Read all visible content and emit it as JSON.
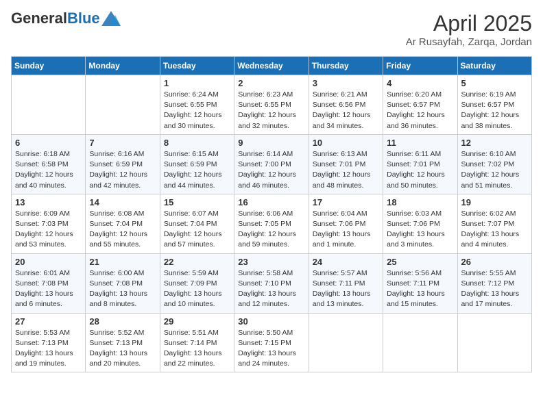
{
  "header": {
    "logo_general": "General",
    "logo_blue": "Blue",
    "month_title": "April 2025",
    "location": "Ar Rusayfah, Zarqa, Jordan"
  },
  "days_of_week": [
    "Sunday",
    "Monday",
    "Tuesday",
    "Wednesday",
    "Thursday",
    "Friday",
    "Saturday"
  ],
  "weeks": [
    [
      {
        "day": "",
        "info": ""
      },
      {
        "day": "",
        "info": ""
      },
      {
        "day": "1",
        "info": "Sunrise: 6:24 AM\nSunset: 6:55 PM\nDaylight: 12 hours and 30 minutes."
      },
      {
        "day": "2",
        "info": "Sunrise: 6:23 AM\nSunset: 6:55 PM\nDaylight: 12 hours and 32 minutes."
      },
      {
        "day": "3",
        "info": "Sunrise: 6:21 AM\nSunset: 6:56 PM\nDaylight: 12 hours and 34 minutes."
      },
      {
        "day": "4",
        "info": "Sunrise: 6:20 AM\nSunset: 6:57 PM\nDaylight: 12 hours and 36 minutes."
      },
      {
        "day": "5",
        "info": "Sunrise: 6:19 AM\nSunset: 6:57 PM\nDaylight: 12 hours and 38 minutes."
      }
    ],
    [
      {
        "day": "6",
        "info": "Sunrise: 6:18 AM\nSunset: 6:58 PM\nDaylight: 12 hours and 40 minutes."
      },
      {
        "day": "7",
        "info": "Sunrise: 6:16 AM\nSunset: 6:59 PM\nDaylight: 12 hours and 42 minutes."
      },
      {
        "day": "8",
        "info": "Sunrise: 6:15 AM\nSunset: 6:59 PM\nDaylight: 12 hours and 44 minutes."
      },
      {
        "day": "9",
        "info": "Sunrise: 6:14 AM\nSunset: 7:00 PM\nDaylight: 12 hours and 46 minutes."
      },
      {
        "day": "10",
        "info": "Sunrise: 6:13 AM\nSunset: 7:01 PM\nDaylight: 12 hours and 48 minutes."
      },
      {
        "day": "11",
        "info": "Sunrise: 6:11 AM\nSunset: 7:01 PM\nDaylight: 12 hours and 50 minutes."
      },
      {
        "day": "12",
        "info": "Sunrise: 6:10 AM\nSunset: 7:02 PM\nDaylight: 12 hours and 51 minutes."
      }
    ],
    [
      {
        "day": "13",
        "info": "Sunrise: 6:09 AM\nSunset: 7:03 PM\nDaylight: 12 hours and 53 minutes."
      },
      {
        "day": "14",
        "info": "Sunrise: 6:08 AM\nSunset: 7:04 PM\nDaylight: 12 hours and 55 minutes."
      },
      {
        "day": "15",
        "info": "Sunrise: 6:07 AM\nSunset: 7:04 PM\nDaylight: 12 hours and 57 minutes."
      },
      {
        "day": "16",
        "info": "Sunrise: 6:06 AM\nSunset: 7:05 PM\nDaylight: 12 hours and 59 minutes."
      },
      {
        "day": "17",
        "info": "Sunrise: 6:04 AM\nSunset: 7:06 PM\nDaylight: 13 hours and 1 minute."
      },
      {
        "day": "18",
        "info": "Sunrise: 6:03 AM\nSunset: 7:06 PM\nDaylight: 13 hours and 3 minutes."
      },
      {
        "day": "19",
        "info": "Sunrise: 6:02 AM\nSunset: 7:07 PM\nDaylight: 13 hours and 4 minutes."
      }
    ],
    [
      {
        "day": "20",
        "info": "Sunrise: 6:01 AM\nSunset: 7:08 PM\nDaylight: 13 hours and 6 minutes."
      },
      {
        "day": "21",
        "info": "Sunrise: 6:00 AM\nSunset: 7:08 PM\nDaylight: 13 hours and 8 minutes."
      },
      {
        "day": "22",
        "info": "Sunrise: 5:59 AM\nSunset: 7:09 PM\nDaylight: 13 hours and 10 minutes."
      },
      {
        "day": "23",
        "info": "Sunrise: 5:58 AM\nSunset: 7:10 PM\nDaylight: 13 hours and 12 minutes."
      },
      {
        "day": "24",
        "info": "Sunrise: 5:57 AM\nSunset: 7:11 PM\nDaylight: 13 hours and 13 minutes."
      },
      {
        "day": "25",
        "info": "Sunrise: 5:56 AM\nSunset: 7:11 PM\nDaylight: 13 hours and 15 minutes."
      },
      {
        "day": "26",
        "info": "Sunrise: 5:55 AM\nSunset: 7:12 PM\nDaylight: 13 hours and 17 minutes."
      }
    ],
    [
      {
        "day": "27",
        "info": "Sunrise: 5:53 AM\nSunset: 7:13 PM\nDaylight: 13 hours and 19 minutes."
      },
      {
        "day": "28",
        "info": "Sunrise: 5:52 AM\nSunset: 7:13 PM\nDaylight: 13 hours and 20 minutes."
      },
      {
        "day": "29",
        "info": "Sunrise: 5:51 AM\nSunset: 7:14 PM\nDaylight: 13 hours and 22 minutes."
      },
      {
        "day": "30",
        "info": "Sunrise: 5:50 AM\nSunset: 7:15 PM\nDaylight: 13 hours and 24 minutes."
      },
      {
        "day": "",
        "info": ""
      },
      {
        "day": "",
        "info": ""
      },
      {
        "day": "",
        "info": ""
      }
    ]
  ]
}
